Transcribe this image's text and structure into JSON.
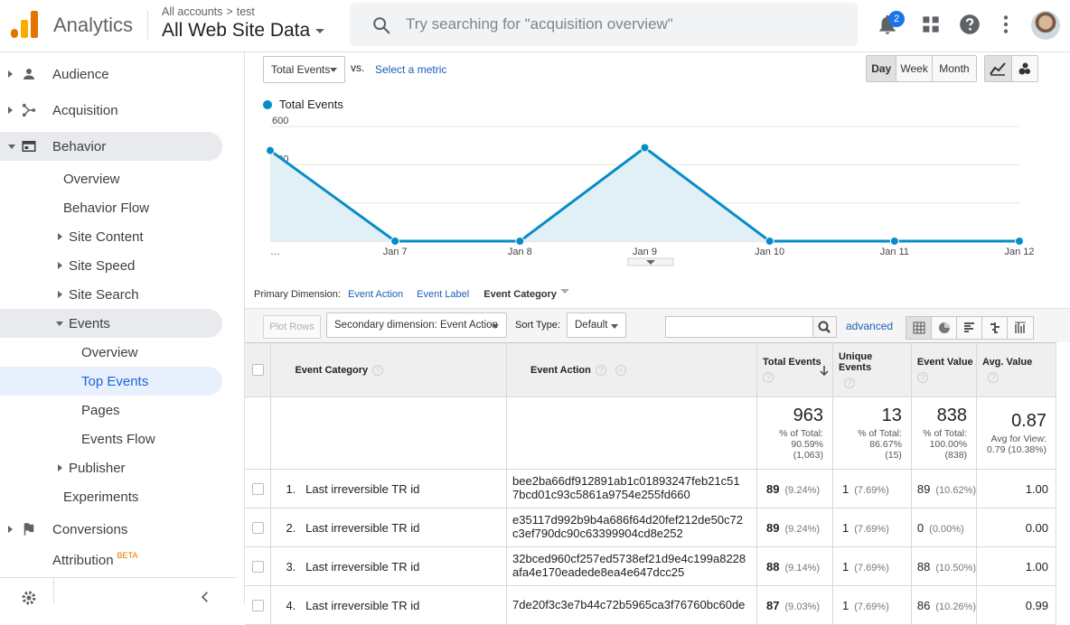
{
  "header": {
    "app_name": "Analytics",
    "breadcrumb_root": "All accounts",
    "breadcrumb_sep": ">",
    "breadcrumb_account": "test",
    "property": "All Web Site Data",
    "search_placeholder": "Try searching for \"acquisition overview\"",
    "notifications_count": "2"
  },
  "sidebar": {
    "items": [
      {
        "label": "Audience",
        "icon": "person-icon"
      },
      {
        "label": "Acquisition",
        "icon": "acquisition-icon"
      },
      {
        "label": "Behavior",
        "icon": "behavior-icon"
      },
      {
        "label": "Overview"
      },
      {
        "label": "Behavior Flow"
      },
      {
        "label": "Site Content"
      },
      {
        "label": "Site Speed"
      },
      {
        "label": "Site Search"
      },
      {
        "label": "Events"
      },
      {
        "label": "Overview"
      },
      {
        "label": "Top Events"
      },
      {
        "label": "Pages"
      },
      {
        "label": "Events Flow"
      },
      {
        "label": "Publisher"
      },
      {
        "label": "Experiments"
      },
      {
        "label": "Conversions",
        "icon": "flag-icon"
      },
      {
        "label": "Attribution",
        "badge": "BETA"
      }
    ]
  },
  "controls": {
    "metric_select": "Total Events",
    "vs": "vs.",
    "select_metric": "Select a metric",
    "periods": [
      "Day",
      "Week",
      "Month"
    ],
    "active_period": "Day"
  },
  "chart_data": {
    "type": "area",
    "series": [
      {
        "name": "Total Events",
        "values": [
          474,
          0,
          0,
          489,
          0,
          0,
          0
        ]
      }
    ],
    "x": [
      "…",
      "Jan 7",
      "Jan 8",
      "Jan 9",
      "Jan 10",
      "Jan 11",
      "Jan 12"
    ],
    "yticks": [
      "600",
      "400",
      "200"
    ],
    "ylim": [
      0,
      600
    ],
    "grid": true,
    "color": "#058dc7"
  },
  "primary_dimension": {
    "label": "Primary Dimension:",
    "options": [
      "Event Action",
      "Event Label",
      "Event Category"
    ],
    "active": "Event Category"
  },
  "table_toolbar": {
    "plot_rows": "Plot Rows",
    "secondary_dimension": "Secondary dimension: Event Action",
    "sort_type_label": "Sort Type:",
    "sort_type": "Default",
    "advanced": "advanced"
  },
  "table": {
    "columns": [
      "Event Category",
      "Event Action",
      "Total Events",
      "Unique Events",
      "Event Value",
      "Avg. Value"
    ],
    "totals": {
      "total_events": "963",
      "total_events_sub1": "% of Total:",
      "total_events_sub2": "90.59%",
      "total_events_sub3": "(1,063)",
      "unique_events": "13",
      "unique_events_sub1": "% of Total:",
      "unique_events_sub2": "86.67%",
      "unique_events_sub3": "(15)",
      "event_value": "838",
      "event_value_sub1": "% of Total:",
      "event_value_sub2": "100.00%",
      "event_value_sub3": "(838)",
      "avg_value": "0.87",
      "avg_value_sub1": "Avg for View:",
      "avg_value_sub2": "0.79 (10.38%)"
    },
    "rows": [
      {
        "num": "1.",
        "category": "Last irreversible TR id",
        "action1": "bee2ba66df912891ab1c01893247feb21c51",
        "action2": "7bcd01c93c5861a9754e255fd660",
        "total": "89",
        "total_pct": "(9.24%)",
        "unique": "1",
        "unique_pct": "(7.69%)",
        "value": "89",
        "value_pct": "(10.62%)",
        "avg": "1.00"
      },
      {
        "num": "2.",
        "category": "Last irreversible TR id",
        "action1": "e35117d992b9b4a686f64d20fef212de50c72",
        "action2": "c3ef790dc90c63399904cd8e252",
        "total": "89",
        "total_pct": "(9.24%)",
        "unique": "1",
        "unique_pct": "(7.69%)",
        "value": "0",
        "value_pct": "(0.00%)",
        "avg": "0.00"
      },
      {
        "num": "3.",
        "category": "Last irreversible TR id",
        "action1": "32bced960cf257ed5738ef21d9e4c199a8228",
        "action2": "afa4e170eadede8ea4e647dcc25",
        "total": "88",
        "total_pct": "(9.14%)",
        "unique": "1",
        "unique_pct": "(7.69%)",
        "value": "88",
        "value_pct": "(10.50%)",
        "avg": "1.00"
      },
      {
        "num": "4.",
        "category": "Last irreversible TR id",
        "action1": "7de20f3c3e7b44c72b5965ca3f76760bc60de",
        "action2": "",
        "total": "87",
        "total_pct": "(9.03%)",
        "unique": "1",
        "unique_pct": "(7.69%)",
        "value": "86",
        "value_pct": "(10.26%)",
        "avg": "0.99"
      }
    ]
  }
}
